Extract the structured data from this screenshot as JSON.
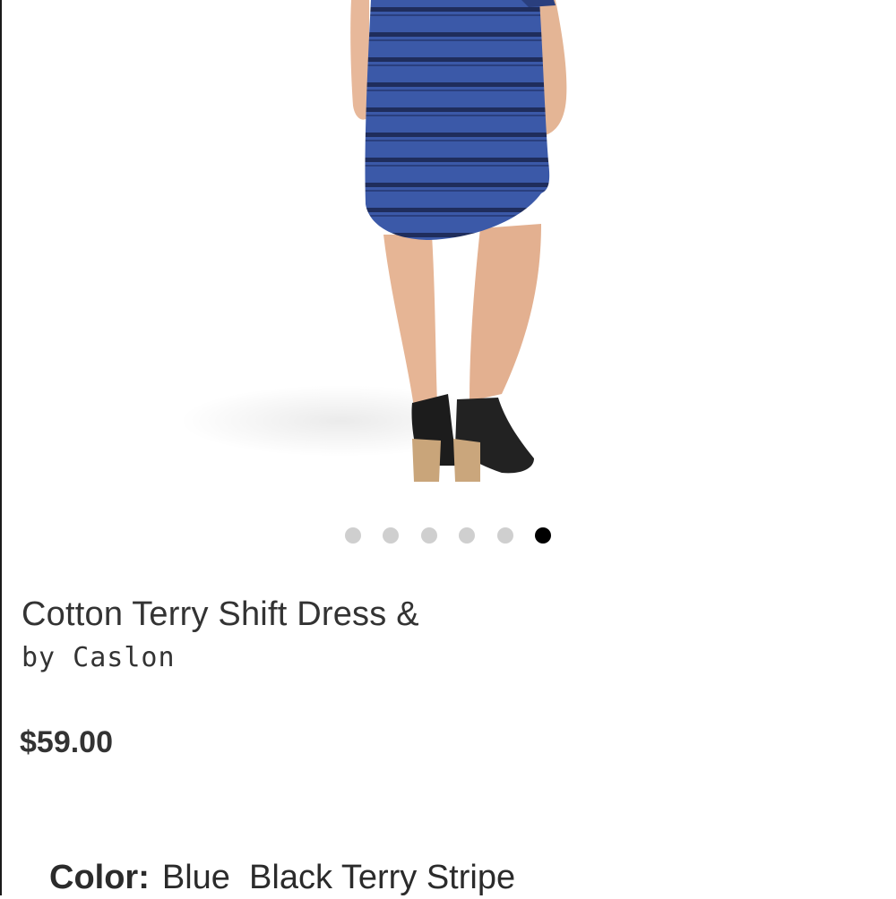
{
  "product": {
    "image": {
      "description_icon": "product-photo-dress"
    },
    "carousel": {
      "count": 6,
      "active_index": 5
    },
    "title": "Cotton Terry Shift Dress &",
    "brand": "by Caslon",
    "price": "$59.00",
    "color": {
      "label": "Color:",
      "value": "Blue  Black Terry Stripe"
    }
  },
  "colors": {
    "dot_inactive": "#cfcfcf",
    "dot_active": "#000000",
    "dress": "#3b59a8",
    "stripe": "#1f2d5c"
  }
}
